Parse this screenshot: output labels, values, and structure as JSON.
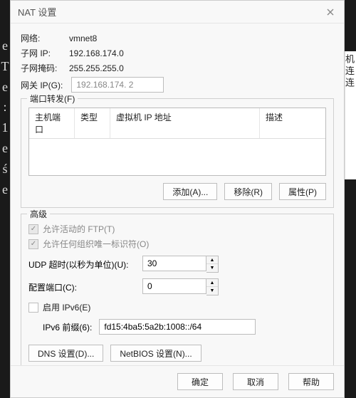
{
  "title": "NAT 设置",
  "info": {
    "network_label": "网络:",
    "network_value": "vmnet8",
    "subnet_ip_label": "子网 IP:",
    "subnet_ip_value": "192.168.174.0",
    "subnet_mask_label": "子网掩码:",
    "subnet_mask_value": "255.255.255.0",
    "gateway_label": "网关 IP(G):",
    "gateway_value": "192.168.174. 2"
  },
  "portfwd": {
    "legend": "端口转发(F)",
    "cols": {
      "host_port": "主机端口",
      "type": "类型",
      "vm_ip": "虚拟机 IP 地址",
      "desc": "描述"
    },
    "add": "添加(A)...",
    "remove": "移除(R)",
    "props": "属性(P)"
  },
  "advanced": {
    "legend": "高级",
    "allow_active_ftp": "允许活动的 FTP(T)",
    "allow_any_oui": "允许任何组织唯一标识符(O)",
    "udp_timeout_label": "UDP 超时(以秒为单位)(U):",
    "udp_timeout_value": "30",
    "config_port_label": "配置端口(C):",
    "config_port_value": "0",
    "enable_ipv6": "启用 IPv6(E)",
    "ipv6_prefix_label": "IPv6 前缀(6):",
    "ipv6_prefix_value": "fd15:4ba5:5a2b:1008::/64",
    "dns_btn": "DNS 设置(D)...",
    "netbios_btn": "NetBIOS 设置(N)..."
  },
  "footer": {
    "ok": "确定",
    "cancel": "取消",
    "help": "帮助"
  }
}
